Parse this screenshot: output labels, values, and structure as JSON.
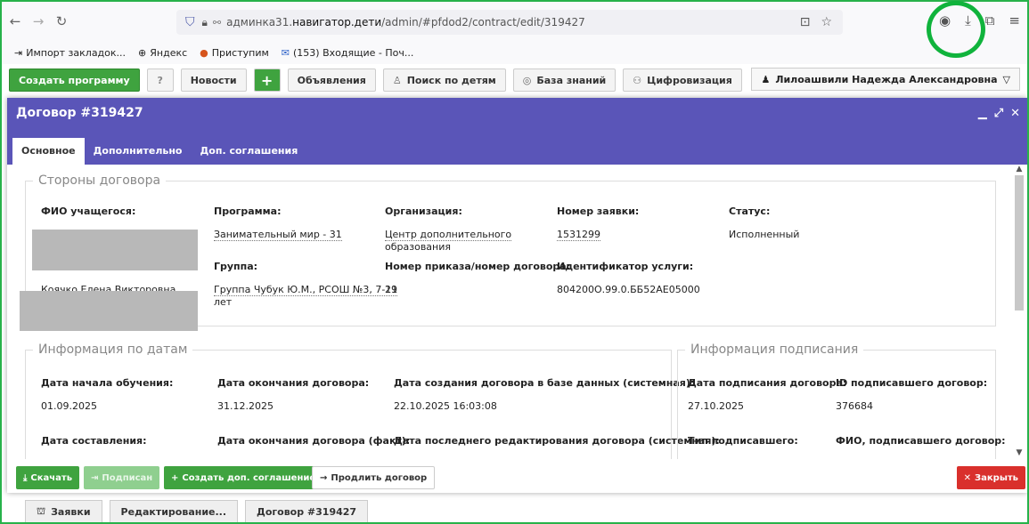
{
  "browser": {
    "url_prefix": "админка31.",
    "url_domain": "навигатор.дети",
    "url_path": "/admin/#pfdod2/contract/edit/319427"
  },
  "bookmarks": [
    {
      "icon": "import-icon",
      "label": "Импорт закладок..."
    },
    {
      "icon": "globe-icon",
      "label": "Яндекс"
    },
    {
      "icon": "flame-icon",
      "label": "Приступим"
    },
    {
      "icon": "mail-icon",
      "label": "(153) Входящие - Поч..."
    }
  ],
  "toolbar": {
    "create_program": "Создать программу",
    "news": "Новости",
    "announcements": "Объявления",
    "children_search": "Поиск по детям",
    "knowledge_base": "База знаний",
    "digitalization": "Цифровизация",
    "user_name": "Лилоашвили Надежда Александровна"
  },
  "modal": {
    "title": "Договор #319427",
    "tabs": [
      "Основное",
      "Дополнительно",
      "Доп. соглашения"
    ]
  },
  "parties": {
    "legend": "Стороны договора",
    "student_label": "ФИО учащегося:",
    "student_name": "Коячко Елена Викторовна",
    "program_label": "Программа:",
    "program_value": "Занимательный мир - 31",
    "group_label": "Группа:",
    "group_value_1": "Группа Чубук Ю.М., РСОШ №3, 7-11",
    "group_value_2": "лет",
    "org_label": "Организация:",
    "org_value_1": "Центр дополнительного",
    "org_value_2": "образования",
    "order_label": "Номер приказа/номер договора:",
    "order_value": "29",
    "request_label": "Номер заявки:",
    "request_value": "1531299",
    "service_label": "Идентификатор услуги:",
    "service_value": "804200О.99.0.ББ52АЕ05000",
    "status_label": "Статус:",
    "status_value": "Исполненный"
  },
  "dates": {
    "legend": "Информация по датам",
    "start_label": "Дата начала обучения:",
    "start_value": "01.09.2025",
    "end_label": "Дата окончания договора:",
    "end_value": "31.12.2025",
    "created_label": "Дата создания договора в базе данных (системная):",
    "created_value": "22.10.2025 16:03:08",
    "composed_label": "Дата составления:",
    "end_fact_label": "Дата окончания договора (факт):",
    "edited_label": "Дата последнего редактирования договора (системная):"
  },
  "signing": {
    "legend": "Информация подписания",
    "sign_date_label": "Дата подписания договора:",
    "sign_date_value": "27.10.2025",
    "signer_id_label": "ID подписавшего договор:",
    "signer_id_value": "376684",
    "signer_type_label": "Тип подписавшего:",
    "signer_name_label": "ФИО, подписавшего договор:"
  },
  "footer": {
    "download": "Скачать",
    "signed": "Подписан",
    "create_agreement": "Создать доп. соглашение",
    "extend": "Продлить договор",
    "close": "Закрыть"
  },
  "taskbar": [
    "Заявки",
    "Редактирование...",
    "Договор #319427"
  ]
}
